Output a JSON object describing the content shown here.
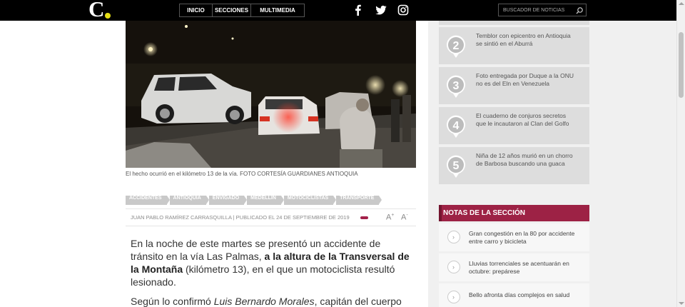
{
  "header": {
    "logo_letter": "C.",
    "logo_dot_color": "#e6df14",
    "nav": [
      "INICIO",
      "SECCIONES",
      "MULTIMEDIA"
    ],
    "social_icons": [
      "facebook-icon",
      "twitter-icon",
      "instagram-icon"
    ],
    "search_placeholder": "BUSCADOR DE NOTICIAS"
  },
  "photo": {
    "caption": "El hecho ocurrió en el kilómetro 13 de la vía. FOTO CORTESÍA GUARDIANES ANTIOQUIA"
  },
  "tags": [
    "ACCIDENTES",
    "ANTIOQUIA",
    "ENVIGADO",
    "MEDELLÍN",
    "MOTOCICLISTAS",
    "TRANSPORTE"
  ],
  "byline": {
    "text": "JUAN PABLO RAMÍREZ CARRASQUILLA | PUBLICADO EL 24 DE SEPTIEMBRE DE 2019",
    "font_increase": "A",
    "font_decrease": "A",
    "plus": "+",
    "minus": "-"
  },
  "article": {
    "p1_a": "En la noche de este martes se presentó un accidente de tránsito en la vía Las Palmas, ",
    "p1_bold": "a la altura de la Transversal de la Montaña",
    "p1_b": " (kilómetro 13), en el que un motociclista resultó lesionado.",
    "p2_a": "Según lo confirmó ",
    "p2_italic": "Luis Bernardo Morales",
    "p2_b": ", capitán del cuerpo"
  },
  "sidebar": {
    "ranked": [
      {
        "number": "2",
        "title": "Temblor con epicentro en Antioquia se sintió en el Aburrá"
      },
      {
        "number": "3",
        "title": "Foto entregada por Duque a la ONU no es del Eln en Venezuela"
      },
      {
        "number": "4",
        "title": "El cuaderno de conjuros secretos que le incautaron al Clan del Golfo"
      },
      {
        "number": "5",
        "title": "Niña de 12 años murió en un chorro de Barbosa buscando una guaca"
      }
    ],
    "section_title": "NOTAS DE LA SECCIÓN",
    "notes": [
      {
        "title": "Gran congestión en la 80 por accidente entre carro y bicicleta"
      },
      {
        "title": "Lluvias torrenciales se acentuarán en octubre: prepárese"
      },
      {
        "title": "Bello afronta días complejos en salud"
      }
    ],
    "accent_color": "#9d2245"
  }
}
